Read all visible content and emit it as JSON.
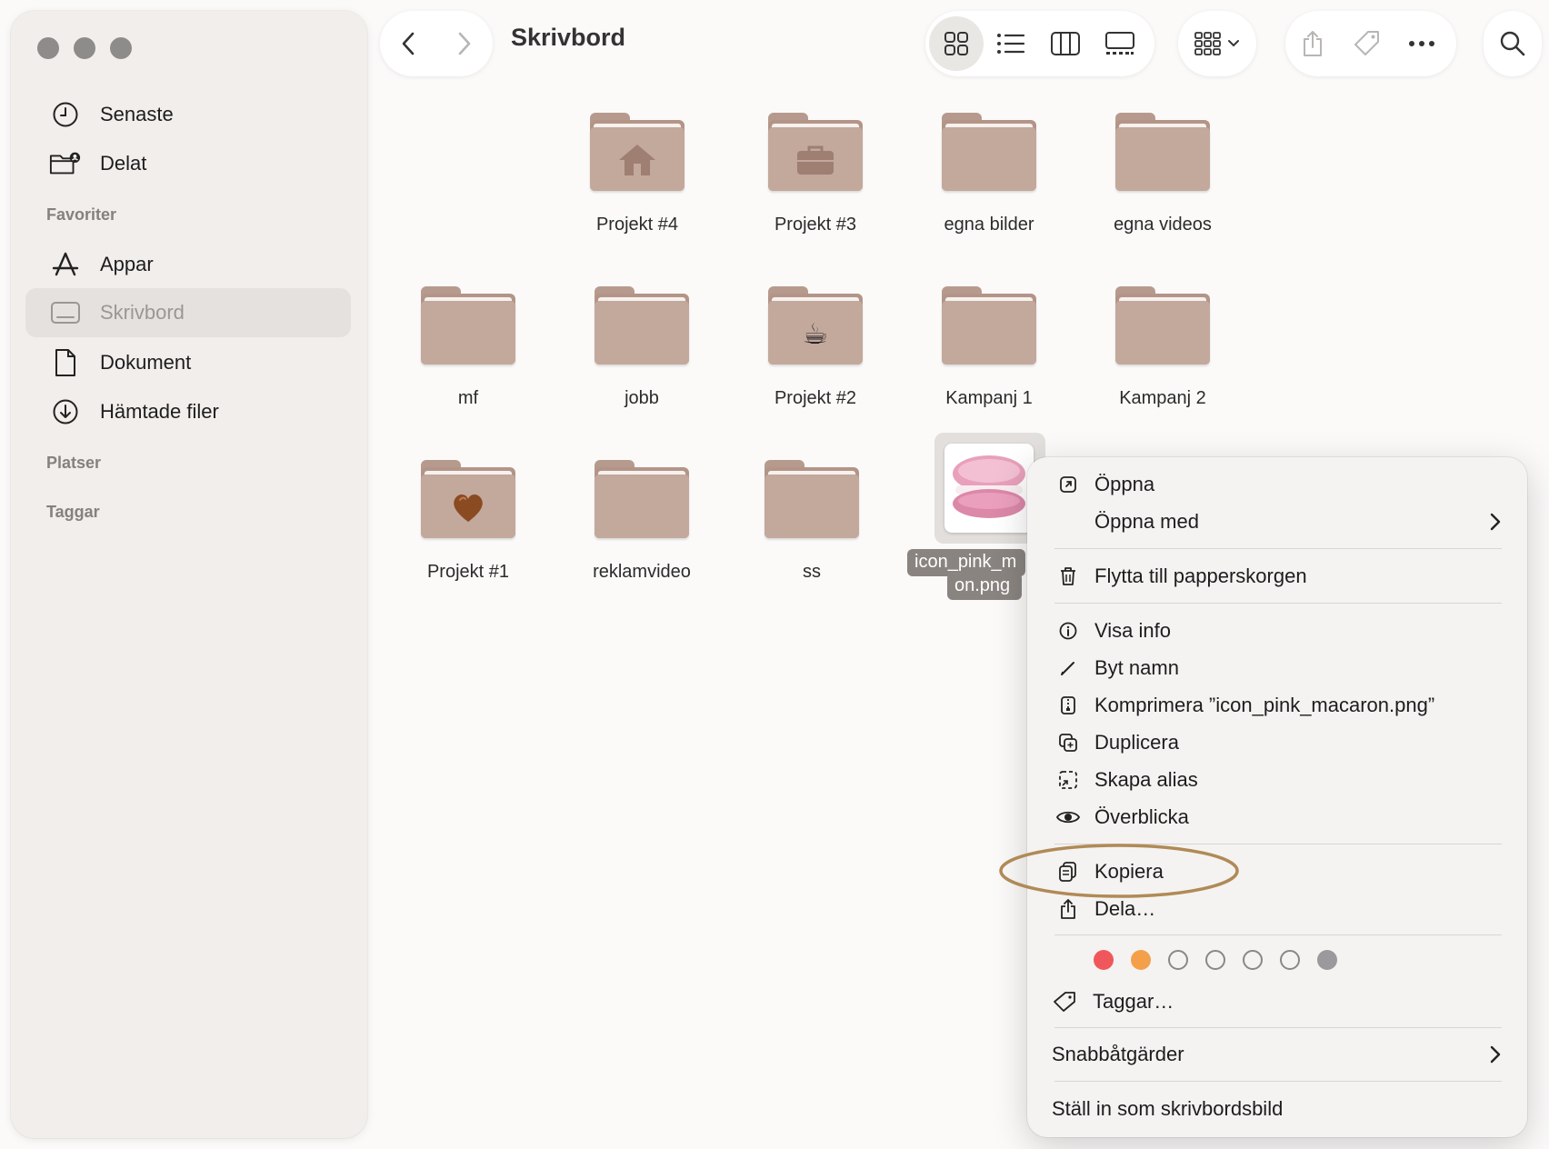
{
  "window": {
    "title": "Skrivbord"
  },
  "sidebar": {
    "items_top": [
      {
        "label": "Senaste",
        "icon": "clock-icon"
      },
      {
        "label": "Delat",
        "icon": "shared-folder-icon"
      }
    ],
    "favorites_heading": "Favoriter",
    "favorites": [
      {
        "label": "Appar",
        "icon": "app-store-icon"
      },
      {
        "label": "Skrivbord",
        "icon": "desktop-icon",
        "selected": true
      },
      {
        "label": "Dokument",
        "icon": "document-icon"
      },
      {
        "label": "Hämtade filer",
        "icon": "download-icon"
      }
    ],
    "places_heading": "Platser",
    "tags_heading": "Taggar"
  },
  "toolbar": {
    "view_modes": [
      "icon-view",
      "list-view",
      "column-view",
      "gallery-view"
    ],
    "selected_view": "icon-view"
  },
  "files": [
    {
      "name": "Projekt #4",
      "type": "folder",
      "glyph": "house"
    },
    {
      "name": "Projekt #3",
      "type": "folder",
      "glyph": "briefcase"
    },
    {
      "name": "egna bilder",
      "type": "folder"
    },
    {
      "name": "egna videos",
      "type": "folder"
    },
    {
      "name": "mf",
      "type": "folder"
    },
    {
      "name": "jobb",
      "type": "folder"
    },
    {
      "name": "Projekt #2",
      "type": "folder",
      "glyph": "☕"
    },
    {
      "name": "Kampanj 1",
      "type": "folder"
    },
    {
      "name": "Kampanj 2",
      "type": "folder"
    },
    {
      "name": "Projekt #1",
      "type": "folder",
      "glyph": "heart"
    },
    {
      "name": "reklamvideo",
      "type": "folder"
    },
    {
      "name": "ss",
      "type": "folder"
    },
    {
      "name_line1": "icon_pink_m",
      "name_line2": "on.png",
      "type": "image",
      "selected": true
    }
  ],
  "context_menu": {
    "open": "Öppna",
    "open_with": "Öppna med",
    "move_to_trash": "Flytta till papperskorgen",
    "get_info": "Visa info",
    "rename": "Byt namn",
    "compress": "Komprimera ”icon_pink_macaron.png”",
    "duplicate": "Duplicera",
    "make_alias": "Skapa alias",
    "quick_look": "Överblicka",
    "copy": "Kopiera",
    "share": "Dela…",
    "tag_colors": [
      "#f0575c",
      "#f4a04a",
      "none",
      "none",
      "none",
      "none",
      "#9a999c"
    ],
    "tags": "Taggar…",
    "quick_actions": "Snabbåtgärder",
    "set_desktop_picture": "Ställ in som skrivbordsbild",
    "highlight_color": "#b08a57"
  }
}
